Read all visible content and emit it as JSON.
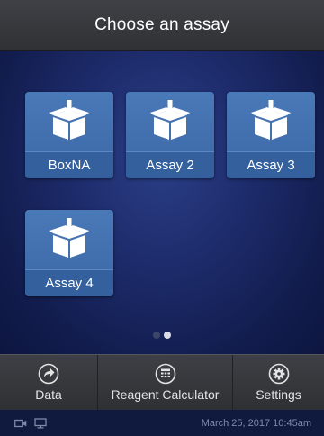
{
  "header": {
    "title": "Choose an assay"
  },
  "assays": [
    {
      "label": "BoxNA",
      "icon": "box-download-icon"
    },
    {
      "label": "Assay 2",
      "icon": "box-download-icon"
    },
    {
      "label": "Assay 3",
      "icon": "box-download-icon"
    },
    {
      "label": "Assay 4",
      "icon": "box-download-icon"
    }
  ],
  "pager": {
    "pages": 2,
    "current_page": 2
  },
  "toolbar": {
    "data_label": "Data",
    "reagent_label": "Reagent Calculator",
    "settings_label": "Settings"
  },
  "status": {
    "datetime": "March 25, 2017 10:45am",
    "icons": [
      "camera-icon",
      "monitor-icon"
    ]
  },
  "colors": {
    "tile": "#3b67a6",
    "header": "#36383c",
    "background": "#1d2b6b",
    "status_text": "#7f89a8"
  }
}
